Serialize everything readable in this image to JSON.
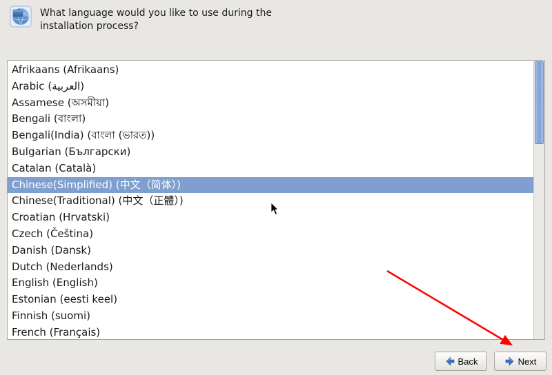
{
  "header": {
    "prompt": "What language would you like to use during the installation process?"
  },
  "languages": [
    {
      "label": "Afrikaans (Afrikaans)",
      "selected": false
    },
    {
      "label": "Arabic (العربية)",
      "selected": false
    },
    {
      "label": "Assamese (অসমীয়া)",
      "selected": false
    },
    {
      "label": "Bengali (বাংলা)",
      "selected": false
    },
    {
      "label": "Bengali(India) (বাংলা (ভারত))",
      "selected": false
    },
    {
      "label": "Bulgarian (Български)",
      "selected": false
    },
    {
      "label": "Catalan (Català)",
      "selected": false
    },
    {
      "label": "Chinese(Simplified) (中文（简体）)",
      "selected": true
    },
    {
      "label": "Chinese(Traditional) (中文（正體）)",
      "selected": false
    },
    {
      "label": "Croatian (Hrvatski)",
      "selected": false
    },
    {
      "label": "Czech (Čeština)",
      "selected": false
    },
    {
      "label": "Danish (Dansk)",
      "selected": false
    },
    {
      "label": "Dutch (Nederlands)",
      "selected": false
    },
    {
      "label": "English (English)",
      "selected": false
    },
    {
      "label": "Estonian (eesti keel)",
      "selected": false
    },
    {
      "label": "Finnish (suomi)",
      "selected": false
    },
    {
      "label": "French (Français)",
      "selected": false
    }
  ],
  "buttons": {
    "back": "Back",
    "next": "Next"
  },
  "colors": {
    "selection": "#7e9fcf",
    "background": "#e9e7e3",
    "annotation": "#ff0000"
  }
}
